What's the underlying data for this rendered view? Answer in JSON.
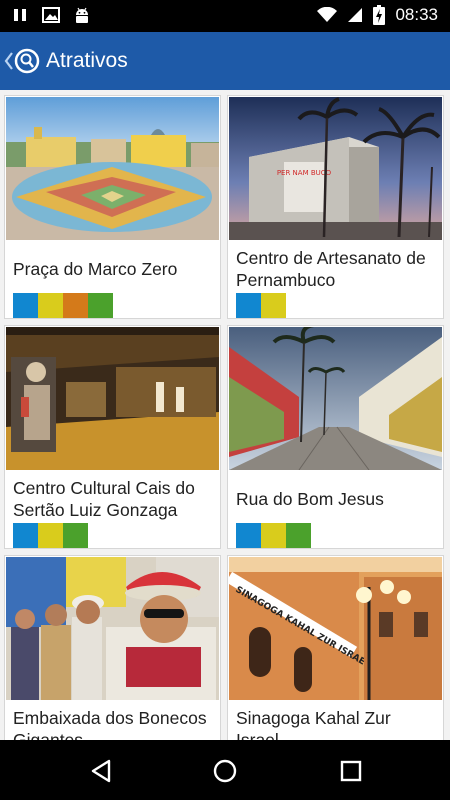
{
  "status_bar": {
    "time": "08:33",
    "left_icons": [
      "pause-icon",
      "image-icon",
      "android-icon"
    ],
    "right_icons": [
      "wifi-icon",
      "signal-icon",
      "battery-charging-icon"
    ]
  },
  "app_bar": {
    "title": "Atrativos",
    "back_icon": "chevron-left-icon",
    "logo_icon": "location-search-icon",
    "color": "#1e5aa8"
  },
  "tag_colors": {
    "blue": "#1187d0",
    "yellow": "#d9cc1c",
    "orange": "#d47a1a",
    "green": "#4ba12c"
  },
  "cards": [
    {
      "label": "Praça do Marco Zero",
      "tags": [
        "blue",
        "yellow",
        "orange",
        "green"
      ]
    },
    {
      "label": "Centro de Artesanato de Pernambuco",
      "tags": [
        "blue",
        "yellow"
      ]
    },
    {
      "label": "Centro Cultural Cais do Sertão Luiz Gonzaga",
      "tags": [
        "blue",
        "yellow",
        "green"
      ]
    },
    {
      "label": "Rua do Bom Jesus",
      "tags": [
        "blue",
        "yellow",
        "green"
      ]
    },
    {
      "label": "Embaixada dos Bonecos Gigantes",
      "tags": []
    },
    {
      "label": "Sinagoga Kahal Zur Israel",
      "tags": []
    }
  ],
  "image_text": {
    "artesanato_sign": "PER NAM BUCO",
    "sinagoga_sign": "SINAGOGA KAHAL ZUR ISRAEL"
  },
  "nav_bar": {
    "buttons": [
      "back-triangle-icon",
      "home-circle-icon",
      "recents-square-icon"
    ]
  }
}
